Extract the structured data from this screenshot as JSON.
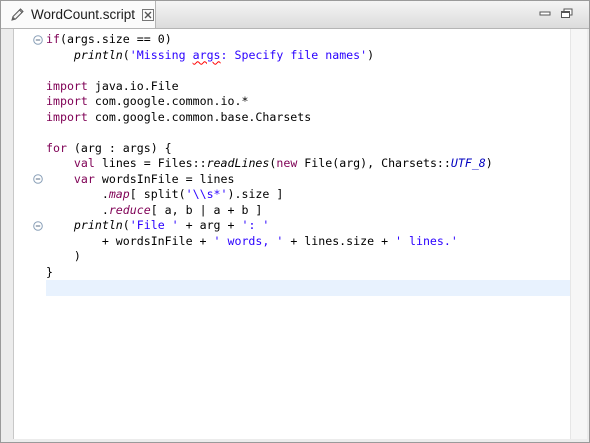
{
  "tab": {
    "title": "WordCount.script",
    "icon": "pencil-icon",
    "close_icon": "close-icon"
  },
  "window_buttons": [
    "minimize-icon",
    "maximize-icon"
  ],
  "colors": {
    "keyword": "#7f0055",
    "string": "#2a00ff",
    "current_line": "#e8f2fe",
    "error_underline": "#ff0000"
  },
  "code": {
    "l1": {
      "a": "if",
      "b": "(args.size == ",
      "c": "0",
      "d": ")"
    },
    "l2": {
      "a": "    ",
      "b": "println",
      "c": "(",
      "d": "'Missing ",
      "e": "args",
      "f": ": Specify file names'",
      "g": ")"
    },
    "l3": "",
    "l4": {
      "a": "import",
      "b": " java.io.File"
    },
    "l5": {
      "a": "import",
      "b": " com.google.common.io.*"
    },
    "l6": {
      "a": "import",
      "b": " com.google.common.base.Charsets"
    },
    "l7": "",
    "l8": {
      "a": "for",
      "b": " (arg : args) {"
    },
    "l9": {
      "a": "    ",
      "b": "val",
      "c": " lines = Files::",
      "d": "readLines",
      "e": "(",
      "f": "new",
      "g": " File(arg), Charsets::",
      "h": "UTF_8",
      "i": ")"
    },
    "l10": {
      "a": "    ",
      "b": "var",
      "c": " wordsInFile = lines"
    },
    "l11": {
      "a": "        .",
      "b": "map",
      "c": "[ split(",
      "d": "'\\\\s*'",
      "e": ").size ]"
    },
    "l12": {
      "a": "        .",
      "b": "reduce",
      "c": "[ a, b | a + b ]"
    },
    "l13": {
      "a": "    ",
      "b": "println",
      "c": "(",
      "d": "'File '",
      "e": " + arg + ",
      "f": "': '"
    },
    "l14": {
      "a": "        + wordsInFile + ",
      "b": "' words, '",
      "c": " + lines.size + ",
      "d": "' lines.'"
    },
    "l15": "    )",
    "l16": "}",
    "l17": ""
  }
}
